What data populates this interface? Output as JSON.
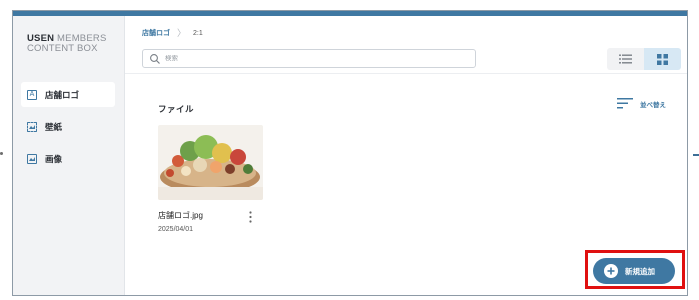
{
  "app": {
    "brand_bold": "USEN",
    "brand_rest": "MEMBERS",
    "brand_line2": "CONTENT BOX"
  },
  "sidebar": {
    "items": [
      {
        "label": "店舗ロゴ",
        "icon": "logo-image-icon",
        "active": true
      },
      {
        "label": "壁紙",
        "icon": "wallpaper-icon",
        "active": false
      },
      {
        "label": "画像",
        "icon": "image-icon",
        "active": false
      }
    ]
  },
  "breadcrumb": {
    "root": "店舗ロゴ",
    "current": "2:1"
  },
  "search": {
    "placeholder": "検索",
    "value": ""
  },
  "view": {
    "list_icon": "list-view-icon",
    "grid_icon": "grid-view-icon",
    "selected": "grid"
  },
  "content": {
    "section_title": "ファイル",
    "sort_label": "並べ替え",
    "files": [
      {
        "name": "店舗ロゴ.jpg",
        "date": "2025/04/01",
        "thumbnail": "food-platter-photo"
      }
    ]
  },
  "actions": {
    "add_label": "新規追加"
  },
  "colors": {
    "accent": "#3f78a2",
    "highlight": "#e01010",
    "sidebar_bg": "#f2f3f5",
    "grid_toggle_bg": "#d7e8f4"
  }
}
